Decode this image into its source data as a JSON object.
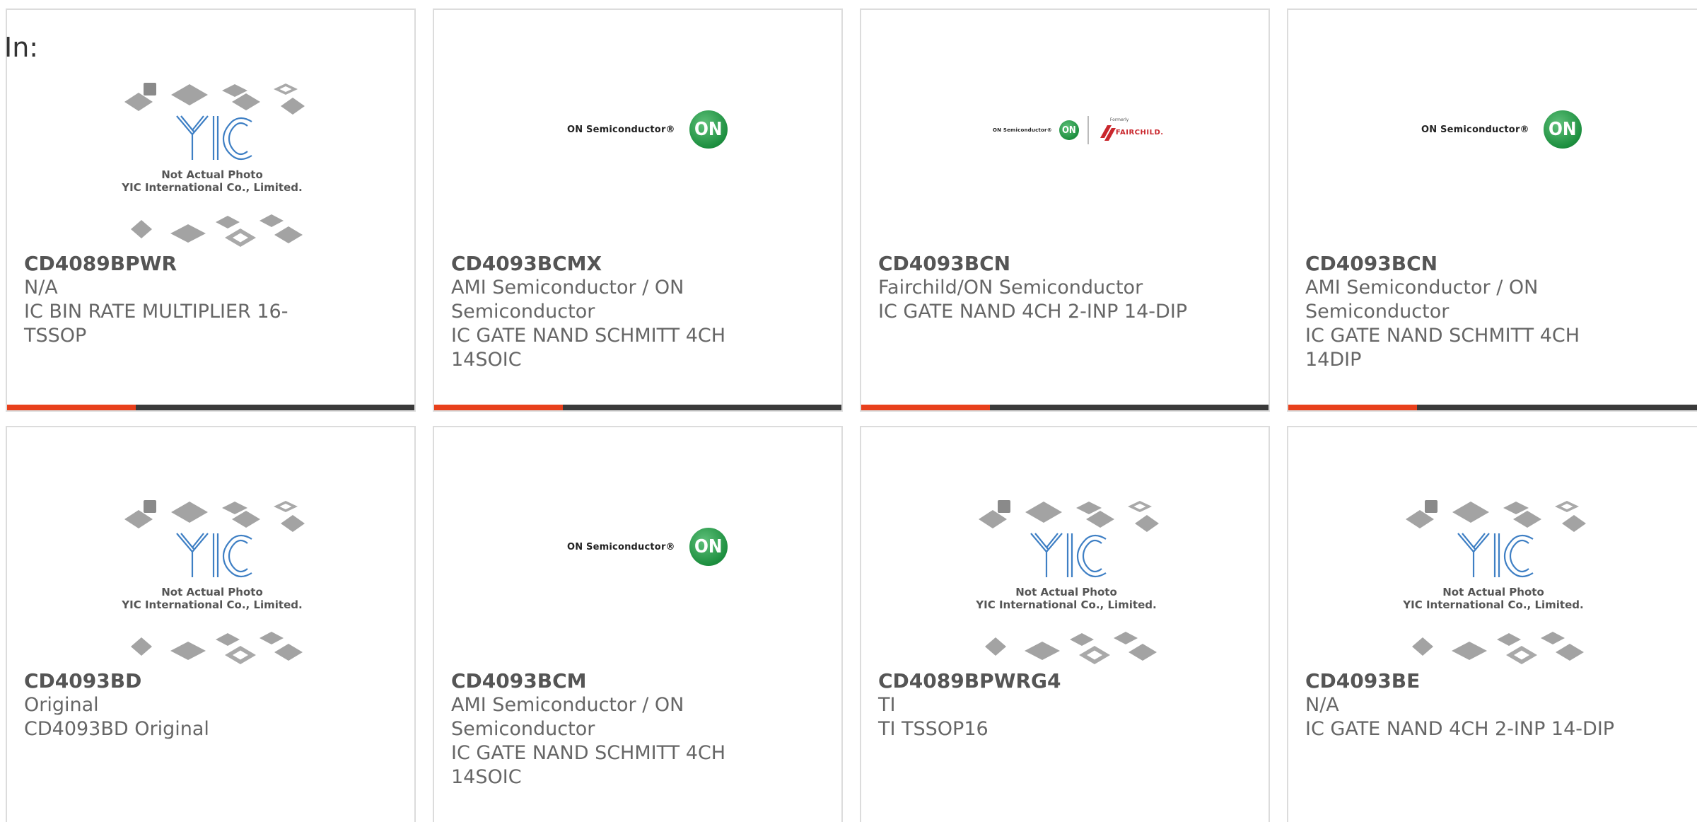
{
  "header": {
    "label": "In:"
  },
  "placeholder": {
    "logo_text": "YIC",
    "caption_line1": "Not Actual Photo",
    "caption_line2": "YIC International Co., Limited."
  },
  "brands": {
    "on_semi_text": "ON Semiconductor®",
    "on_mark": "ON",
    "formerly": "Formerly",
    "fairchild": "FAIRCHILD."
  },
  "colors": {
    "accent": "#e8401c",
    "bar": "#3a3a3a",
    "border": "#dcdcdc",
    "on_green": "#1d8f3f"
  },
  "products": [
    {
      "part": "CD4089BPWR",
      "manufacturer": "N/A",
      "desc1": "IC BIN RATE MULTIPLIER 16-",
      "desc2": "TSSOP",
      "image": "yic-placeholder"
    },
    {
      "part": "CD4093BCMX",
      "manufacturer": "AMI Semiconductor / ON",
      "manufacturer2": "Semiconductor",
      "desc1": "IC GATE NAND SCHMITT 4CH",
      "desc2": "14SOIC",
      "image": "on-semi-logo"
    },
    {
      "part": "CD4093BCN",
      "manufacturer": "Fairchild/ON Semiconductor",
      "desc1": "IC GATE NAND 4CH 2-INP 14-DIP",
      "image": "on-fairchild-logo"
    },
    {
      "part": "CD4093BCN",
      "manufacturer": "AMI Semiconductor / ON",
      "manufacturer2": "Semiconductor",
      "desc1": "IC GATE NAND SCHMITT 4CH",
      "desc2": "14DIP",
      "image": "on-semi-logo"
    },
    {
      "part": "CD4093BD",
      "manufacturer": "Original",
      "desc1": "CD4093BD Original",
      "image": "yic-placeholder"
    },
    {
      "part": "CD4093BCM",
      "manufacturer": "AMI Semiconductor / ON",
      "manufacturer2": "Semiconductor",
      "desc1": "IC GATE NAND SCHMITT 4CH",
      "desc2": "14SOIC",
      "image": "on-semi-logo"
    },
    {
      "part": "CD4089BPWRG4",
      "manufacturer": "TI",
      "desc1": "TI TSSOP16",
      "image": "yic-placeholder"
    },
    {
      "part": "CD4093BE",
      "manufacturer": "N/A",
      "desc1": "IC GATE NAND 4CH 2-INP 14-DIP",
      "image": "yic-placeholder"
    }
  ]
}
